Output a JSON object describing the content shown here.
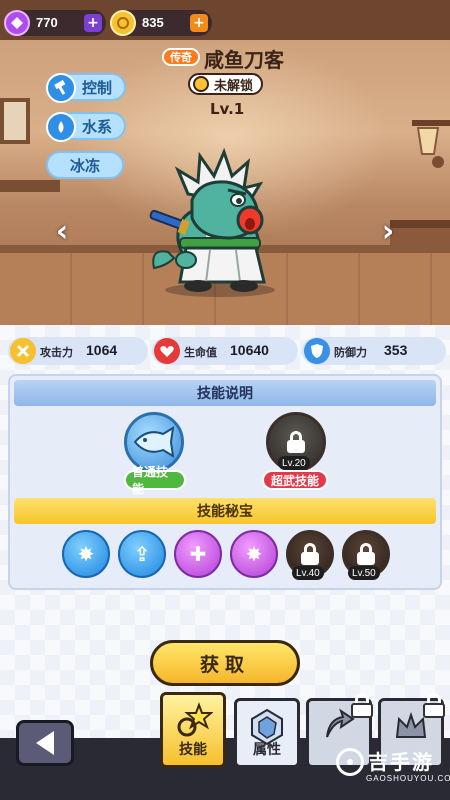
{
  "currency": {
    "gems": "770",
    "coins": "835"
  },
  "hero": {
    "rarity": "传奇",
    "name": "咸鱼刀客",
    "lock_status": "未解锁",
    "level": "Lv.1",
    "tags": [
      "控制",
      "水系",
      "冰冻"
    ]
  },
  "stats": [
    {
      "label": "攻击力",
      "value": "1064"
    },
    {
      "label": "生命值",
      "value": "10640"
    },
    {
      "label": "防御力",
      "value": "353"
    }
  ],
  "skills_section": {
    "title": "技能说明",
    "normal_label": "普通技能",
    "ultimate_label": "超武技能",
    "ultimate_level": "Lv.20"
  },
  "treasure_section": {
    "title": "技能秘宝",
    "locked_levels": [
      "Lv.40",
      "Lv.50"
    ]
  },
  "buttons": {
    "obtain": "获取"
  },
  "tabs": [
    {
      "label": "技能"
    },
    {
      "label": "属性"
    }
  ],
  "watermark": {
    "title": "吉手游",
    "url": "GAOSHOUYOU.COM"
  },
  "colors": {
    "accent_yellow": "#f6c12c",
    "rarity_orange": "#ff7a1a",
    "tag_blue": "#2f8ee6",
    "normal_skill_green": "#4fb93e",
    "ultimate_red": "#e23a4a"
  },
  "icons": {
    "gem": "purple-gem-icon",
    "coin": "gold-coin-icon",
    "control_tag": "hammer-icon",
    "water_tag": "water-drop-icon",
    "attack": "sword-icon",
    "hp": "heart-icon",
    "defense": "shield-icon",
    "locked": "lock-icon"
  }
}
